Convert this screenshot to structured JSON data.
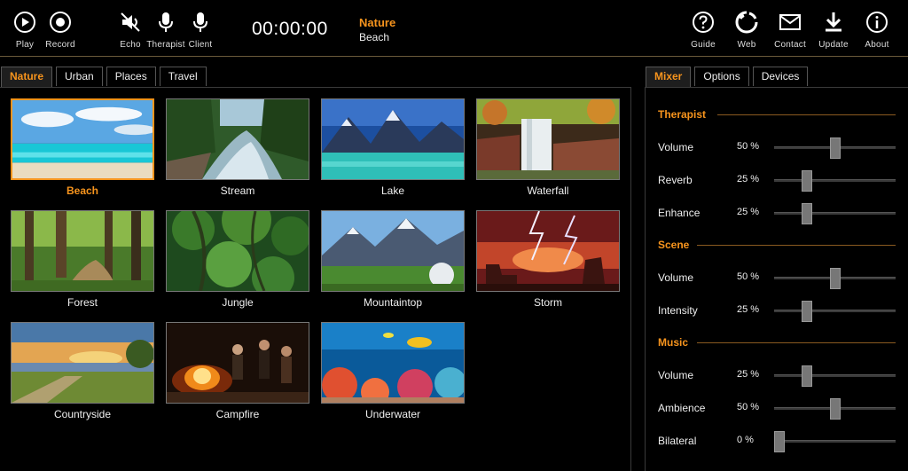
{
  "toolbar": {
    "left_buttons": [
      {
        "label": "Play",
        "icon": "play-icon"
      },
      {
        "label": "Record",
        "icon": "record-icon"
      },
      {
        "label": "Echo",
        "icon": "speaker-muted-icon"
      },
      {
        "label": "Therapist",
        "icon": "microphone-icon"
      },
      {
        "label": "Client",
        "icon": "microphone-icon"
      }
    ],
    "timer": "00:00:00",
    "now_playing": {
      "category": "Nature",
      "scene": "Beach"
    },
    "right_buttons": [
      {
        "label": "Guide",
        "icon": "help-icon"
      },
      {
        "label": "Web",
        "icon": "globe-icon"
      },
      {
        "label": "Contact",
        "icon": "mail-icon"
      },
      {
        "label": "Update",
        "icon": "download-icon"
      },
      {
        "label": "About",
        "icon": "info-icon"
      }
    ]
  },
  "scene_tabs": [
    "Nature",
    "Urban",
    "Places",
    "Travel"
  ],
  "scenes": [
    {
      "name": "Beach",
      "selected": true
    },
    {
      "name": "Stream"
    },
    {
      "name": "Lake"
    },
    {
      "name": "Waterfall"
    },
    {
      "name": "Forest"
    },
    {
      "name": "Jungle"
    },
    {
      "name": "Mountaintop"
    },
    {
      "name": "Storm"
    },
    {
      "name": "Countryside"
    },
    {
      "name": "Campfire"
    },
    {
      "name": "Underwater"
    }
  ],
  "mixer_tabs": [
    "Mixer",
    "Options",
    "Devices"
  ],
  "mixer": {
    "therapist": {
      "title": "Therapist",
      "rows": [
        {
          "name": "Volume",
          "value": "50 %",
          "level": 0.5
        },
        {
          "name": "Reverb",
          "value": "25 %",
          "level": 0.25
        },
        {
          "name": "Enhance",
          "value": "25 %",
          "level": 0.25
        }
      ]
    },
    "scene": {
      "title": "Scene",
      "rows": [
        {
          "name": "Volume",
          "value": "50 %",
          "level": 0.5
        },
        {
          "name": "Intensity",
          "value": "25 %",
          "level": 0.25
        }
      ]
    },
    "music": {
      "title": "Music",
      "rows": [
        {
          "name": "Volume",
          "value": "25 %",
          "level": 0.25
        },
        {
          "name": "Ambience",
          "value": "50 %",
          "level": 0.5
        },
        {
          "name": "Bilateral",
          "value": "0 %",
          "level": 0.0
        }
      ]
    }
  },
  "colors": {
    "accent": "#f7941d",
    "background": "#000000",
    "panel_border": "#3a3a3a"
  }
}
